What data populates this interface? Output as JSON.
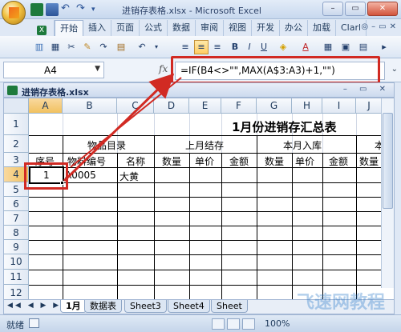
{
  "window": {
    "title": "进销存表格.xlsx - Microsoft Excel",
    "min": "–",
    "max": "▭",
    "close": "✕"
  },
  "ribbon_tabs": [
    "开始",
    "插入",
    "页面",
    "公式",
    "数据",
    "审阅",
    "视图",
    "开发",
    "办公",
    "加载",
    "Clarl"
  ],
  "ribbon_ctrls": [
    "◎",
    "–",
    "▭",
    "✕"
  ],
  "toolbar": {
    "bold": "B",
    "italic": "I",
    "underline": "U",
    "font_color": "A"
  },
  "formula_bar": {
    "name_box": "A4",
    "fx": "fx",
    "formula": "=IF(B4<>\"\",MAX(A$3:A3)+1,\"\")"
  },
  "workbook": {
    "name": "进销存表格.xlsx",
    "buttons": "– ▭ ✕"
  },
  "grid": {
    "columns": [
      "A",
      "B",
      "C",
      "D",
      "E",
      "F",
      "G",
      "H",
      "I",
      "J"
    ],
    "rows": [
      "1",
      "2",
      "3",
      "4",
      "5",
      "6",
      "7",
      "8",
      "9",
      "10",
      "11",
      "12"
    ],
    "title": "1月份进销存汇总表",
    "headers_row2": {
      "item_catalog": "物品目录",
      "last_month": "上月结存",
      "in_this_month": "本月入库",
      "overflow": "本"
    },
    "headers_row3": {
      "seq": "序号",
      "code": "物料编号",
      "name": "名称",
      "qty1": "数量",
      "price1": "单价",
      "amount1": "金额",
      "qty2": "数量",
      "price2": "单价",
      "amount2": "金额",
      "qty3": "数量"
    },
    "row4": {
      "seq": "1",
      "code": "A0005",
      "name": "大黄"
    }
  },
  "sheets": [
    "1月",
    "数据表",
    "Sheet3",
    "Sheet4",
    "Sheet"
  ],
  "status": {
    "text": "就绪",
    "zoom": "100%"
  },
  "watermark": "飞速网教程",
  "colors": {
    "highlight": "#d12a23",
    "accent": "#1d7a3c"
  }
}
